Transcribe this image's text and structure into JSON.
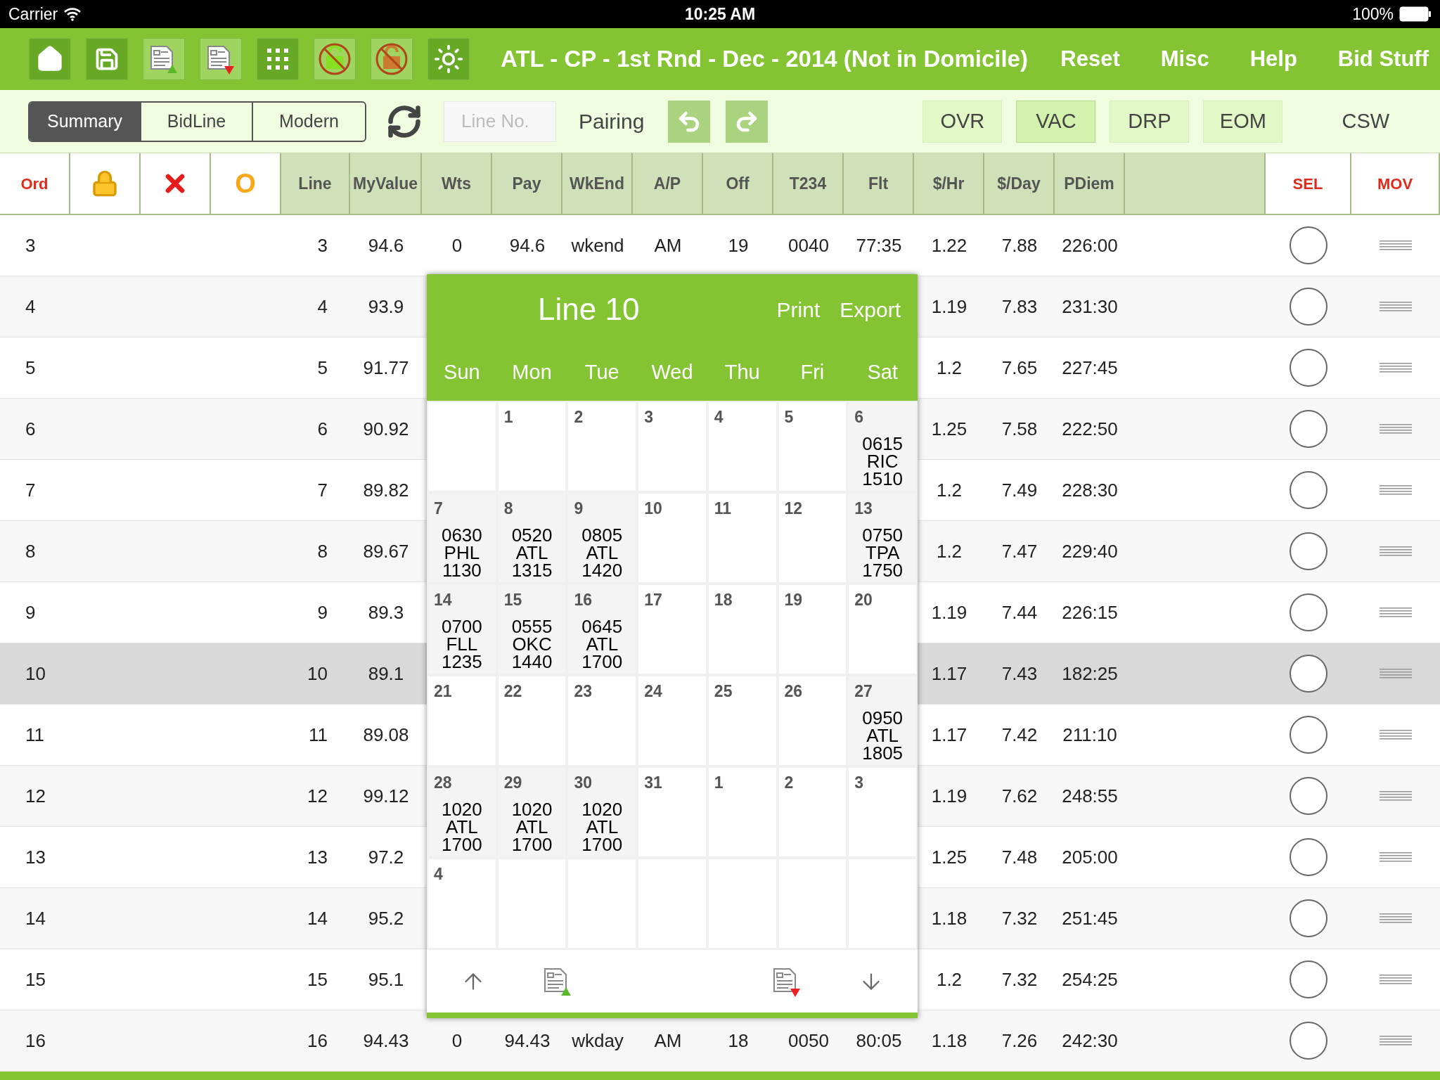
{
  "status_bar": {
    "carrier": "Carrier",
    "time": "10:25 AM",
    "battery": "100%"
  },
  "toolbar": {
    "icons": [
      {
        "kind": "home",
        "dimmed": false
      },
      {
        "kind": "save",
        "dimmed": false
      },
      {
        "kind": "doc-up",
        "dimmed": true
      },
      {
        "kind": "doc-down",
        "dimmed": true
      },
      {
        "kind": "grid",
        "dimmed": false
      },
      {
        "kind": "lock-green",
        "dimmed": true
      },
      {
        "kind": "lock-orange",
        "dimmed": true
      },
      {
        "kind": "sun",
        "dimmed": false
      }
    ],
    "title": "ATL - CP - 1st Rnd - Dec - 2014 (Not in Domicile)",
    "menu": [
      "Reset",
      "Misc",
      "Help",
      "Bid Stuff"
    ]
  },
  "subbar": {
    "views": [
      {
        "label": "Summary",
        "selected": true
      },
      {
        "label": "BidLine",
        "selected": false
      },
      {
        "label": "Modern",
        "selected": false
      }
    ],
    "line_field": {
      "placeholder": "Line No."
    },
    "pairing": "Pairing",
    "filters": [
      {
        "label": "OVR",
        "selected": false
      },
      {
        "label": "VAC",
        "selected": true
      },
      {
        "label": "DRP",
        "selected": false
      },
      {
        "label": "EOM",
        "selected": false
      }
    ],
    "csw": "CSW"
  },
  "table": {
    "columns": [
      {
        "kind": "control",
        "label": "Ord"
      },
      {
        "kind": "lock"
      },
      {
        "kind": "cross"
      },
      {
        "kind": "letter",
        "label": "O"
      },
      {
        "kind": "data",
        "label": "Line"
      },
      {
        "kind": "data",
        "label": "MyValue"
      },
      {
        "kind": "data",
        "label": "Wts"
      },
      {
        "kind": "data",
        "label": "Pay"
      },
      {
        "kind": "data",
        "label": "WkEnd"
      },
      {
        "kind": "data",
        "label": "A/P"
      },
      {
        "kind": "data",
        "label": "Off"
      },
      {
        "kind": "data",
        "label": "T234"
      },
      {
        "kind": "data",
        "label": "Flt"
      },
      {
        "kind": "data",
        "label": "$/Hr"
      },
      {
        "kind": "data",
        "label": "$/Day"
      },
      {
        "kind": "data",
        "label": "PDiem"
      },
      {
        "kind": "blank"
      },
      {
        "kind": "control",
        "label": "SEL"
      },
      {
        "kind": "control",
        "label": "MOV"
      }
    ],
    "rows": [
      {
        "ord": "3",
        "line": "3",
        "myvalue": "94.6",
        "wts": "0",
        "pay": "94.6",
        "wkend": "wkend",
        "ap": "AM",
        "off": "19",
        "t234": "0040",
        "flt": "77:35",
        "per_hr": "1.22",
        "per_day": "7.88",
        "pdiem": "226:00",
        "selected": false,
        "checked": false
      },
      {
        "ord": "4",
        "line": "4",
        "myvalue": "93.9",
        "per_hr": "1.19",
        "per_day": "7.83",
        "pdiem": "231:30",
        "selected": false,
        "checked": false
      },
      {
        "ord": "5",
        "line": "5",
        "myvalue": "91.77",
        "per_hr": "1.2",
        "per_day": "7.65",
        "pdiem": "227:45",
        "selected": false,
        "checked": false
      },
      {
        "ord": "6",
        "line": "6",
        "myvalue": "90.92",
        "per_hr": "1.25",
        "per_day": "7.58",
        "pdiem": "222:50",
        "selected": false,
        "checked": false
      },
      {
        "ord": "7",
        "line": "7",
        "myvalue": "89.82",
        "per_hr": "1.2",
        "per_day": "7.49",
        "pdiem": "228:30",
        "selected": false,
        "checked": false
      },
      {
        "ord": "8",
        "line": "8",
        "myvalue": "89.67",
        "per_hr": "1.2",
        "per_day": "7.47",
        "pdiem": "229:40",
        "selected": false,
        "checked": false
      },
      {
        "ord": "9",
        "line": "9",
        "myvalue": "89.3",
        "per_hr": "1.19",
        "per_day": "7.44",
        "pdiem": "226:15",
        "selected": false,
        "checked": false
      },
      {
        "ord": "10",
        "line": "10",
        "myvalue": "89.1",
        "per_hr": "1.17",
        "per_day": "7.43",
        "pdiem": "182:25",
        "selected": true,
        "checked": false
      },
      {
        "ord": "11",
        "line": "11",
        "myvalue": "89.08",
        "per_hr": "1.17",
        "per_day": "7.42",
        "pdiem": "211:10",
        "selected": false,
        "checked": false
      },
      {
        "ord": "12",
        "line": "12",
        "myvalue": "99.12",
        "per_hr": "1.19",
        "per_day": "7.62",
        "pdiem": "248:55",
        "selected": false,
        "checked": false
      },
      {
        "ord": "13",
        "line": "13",
        "myvalue": "97.2",
        "per_hr": "1.25",
        "per_day": "7.48",
        "pdiem": "205:00",
        "selected": false,
        "checked": false
      },
      {
        "ord": "14",
        "line": "14",
        "myvalue": "95.2",
        "per_hr": "1.18",
        "per_day": "7.32",
        "pdiem": "251:45",
        "selected": false,
        "checked": false
      },
      {
        "ord": "15",
        "line": "15",
        "myvalue": "95.1",
        "per_hr": "1.2",
        "per_day": "7.32",
        "pdiem": "254:25",
        "selected": false,
        "checked": false
      },
      {
        "ord": "16",
        "line": "16",
        "myvalue": "94.43",
        "wts": "0",
        "pay": "94.43",
        "wkend": "wkday",
        "ap": "AM",
        "off": "18",
        "t234": "0050",
        "flt": "80:05",
        "per_hr": "1.18",
        "per_day": "7.26",
        "pdiem": "242:30",
        "selected": false,
        "checked": false
      }
    ]
  },
  "popup": {
    "title": "Line 10",
    "actions": [
      "Print",
      "Export"
    ],
    "weekdays": [
      "Sun",
      "Mon",
      "Tue",
      "Wed",
      "Thu",
      "Fri",
      "Sat"
    ],
    "weeks": [
      [
        {
          "kind": "blank"
        },
        {
          "day": "1"
        },
        {
          "day": "2"
        },
        {
          "day": "3"
        },
        {
          "day": "4"
        },
        {
          "day": "5"
        },
        {
          "day": "6",
          "trip": [
            "0615",
            "RIC",
            "1510"
          ]
        }
      ],
      [
        {
          "day": "7",
          "trip": [
            "0630",
            "PHL",
            "1130"
          ]
        },
        {
          "day": "8",
          "trip": [
            "0520",
            "ATL",
            "1315"
          ]
        },
        {
          "day": "9",
          "trip": [
            "0805",
            "ATL",
            "1420"
          ]
        },
        {
          "day": "10"
        },
        {
          "day": "11"
        },
        {
          "day": "12"
        },
        {
          "day": "13",
          "trip": [
            "0750",
            "TPA",
            "1750"
          ]
        }
      ],
      [
        {
          "day": "14",
          "trip": [
            "0700",
            "FLL",
            "1235"
          ]
        },
        {
          "day": "15",
          "trip": [
            "0555",
            "OKC",
            "1440"
          ]
        },
        {
          "day": "16",
          "trip": [
            "0645",
            "ATL",
            "1700"
          ]
        },
        {
          "day": "17"
        },
        {
          "day": "18"
        },
        {
          "day": "19"
        },
        {
          "day": "20"
        }
      ],
      [
        {
          "day": "21"
        },
        {
          "day": "22"
        },
        {
          "day": "23"
        },
        {
          "day": "24"
        },
        {
          "day": "25"
        },
        {
          "day": "26"
        },
        {
          "day": "27",
          "trip": [
            "0950",
            "ATL",
            "1805"
          ]
        }
      ],
      [
        {
          "day": "28",
          "trip": [
            "1020",
            "ATL",
            "1700"
          ]
        },
        {
          "day": "29",
          "trip": [
            "1020",
            "ATL",
            "1700"
          ]
        },
        {
          "day": "30",
          "trip": [
            "1020",
            "ATL",
            "1700"
          ]
        },
        {
          "day": "31"
        },
        {
          "day": "1"
        },
        {
          "day": "2"
        },
        {
          "day": "3"
        }
      ],
      [
        {
          "day": "4"
        },
        {
          "kind": "blank"
        },
        {
          "kind": "blank"
        },
        {
          "kind": "blank"
        },
        {
          "kind": "blank"
        },
        {
          "kind": "blank"
        },
        {
          "kind": "blank"
        }
      ]
    ]
  }
}
